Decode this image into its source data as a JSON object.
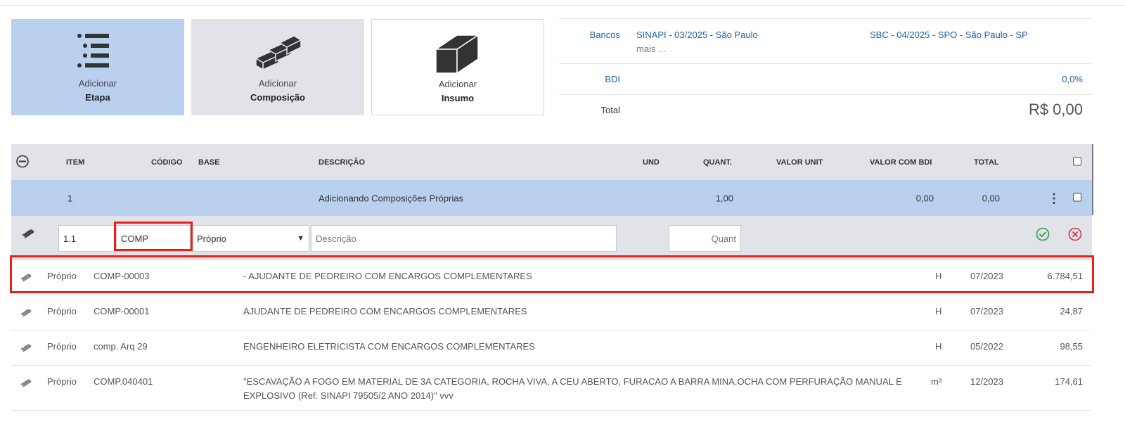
{
  "cards": {
    "etapa": {
      "line1": "Adicionar",
      "line2": "Etapa"
    },
    "composicao": {
      "line1": "Adicionar",
      "line2": "Composição"
    },
    "insumo": {
      "line1": "Adicionar",
      "line2": "Insumo"
    }
  },
  "summary": {
    "bancos_label": "Bancos",
    "banco1": "SINAPI - 03/2025 - São Paulo",
    "mais": "mais ...",
    "banco2": "SBC - 04/2025 - SPO - São Paulo - SP",
    "bdi_label": "BDI",
    "bdi_value": "0,0%",
    "total_label": "Total",
    "total_value": "R$ 0,00"
  },
  "table": {
    "headers": {
      "item": "ITEM",
      "codigo": "CÓDIGO",
      "base": "BASE",
      "descricao": "DESCRIÇÃO",
      "und": "UND",
      "quant": "QUANT.",
      "valor_unit": "VALOR UNIT",
      "valor_bdi": "VALOR COM BDI",
      "total": "TOTAL"
    },
    "row1": {
      "item": "1",
      "descricao": "Adicionando Composições Próprias",
      "quant": "1,00",
      "valor_bdi": "0,00",
      "total": "0,00"
    },
    "edit": {
      "item": "1.1",
      "codigo": "COMP",
      "base": "Próprio",
      "base_options": [
        "Próprio"
      ],
      "descricao_placeholder": "Descrição",
      "quant_placeholder": "Quant"
    }
  },
  "suggestions": [
    {
      "base": "Próprio",
      "code": "COMP-00003",
      "desc1": "- AJUDANTE DE PEDREIRO COM ENCARGOS COMPLEMENTARES",
      "desc2": "",
      "und": "H",
      "date": "07/2023",
      "value": "6.784,51"
    },
    {
      "base": "Próprio",
      "code": "COMP-00001",
      "desc1": "AJUDANTE DE PEDREIRO COM ENCARGOS COMPLEMENTARES",
      "desc2": "",
      "und": "H",
      "date": "07/2023",
      "value": "24,87"
    },
    {
      "base": "Próprio",
      "code": "comp. Arq 29",
      "desc1": "ENGENHEIRO ELETRICISTA COM ENCARGOS COMPLEMENTARES",
      "desc2": "",
      "und": "H",
      "date": "05/2022",
      "value": "98,55"
    },
    {
      "base": "Próprio",
      "code": "COMP.040401",
      "desc1": "\"ESCAVAÇÃO A FOGO EM MATERIAL DE 3A CATEGORIA, ROCHA VIVA, A CEU ABERTO, FURACAO A BARRA MINA.OCHA COM PERFURAÇÃO MANUAL E",
      "desc2": "EXPLOSIVO (Ref. SINAPI 79505/2 ANO 2014)\" vvv",
      "und": "m³",
      "date": "12/2023",
      "value": "174,61"
    }
  ],
  "colors": {
    "accent": "#1f62a8",
    "highlight": "#e8221b",
    "selected_card": "#b9d1ef",
    "confirm": "#2ea043",
    "cancel": "#d9333f"
  }
}
